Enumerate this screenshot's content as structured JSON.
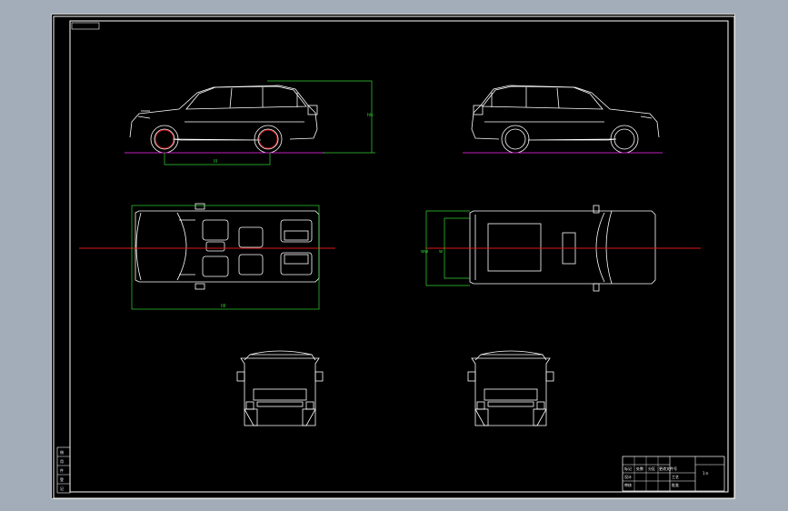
{
  "drawing": {
    "title_block": {
      "scale_label": "1:n",
      "row_labels": [
        "设计",
        "审核",
        "工艺",
        "批准"
      ],
      "revision_headers": [
        "标记",
        "处数",
        "分区",
        "更改文件号",
        "签名",
        "日期"
      ]
    },
    "left_margin_table": [
      "借",
      "用",
      "件",
      "登",
      "记"
    ],
    "dimensions": {
      "side_length": "lll",
      "side_height": "hh",
      "top_length": "llll",
      "top_width": "ww",
      "top_width_inner": "w"
    },
    "colors": {
      "background": "#000000",
      "frame": "#ffffff",
      "vehicle_lines": "#ffffff",
      "dimension": "#34d234",
      "centerline": "#e01818",
      "ground_line": "#c020c0",
      "window_bg": "#a3adb9"
    }
  }
}
